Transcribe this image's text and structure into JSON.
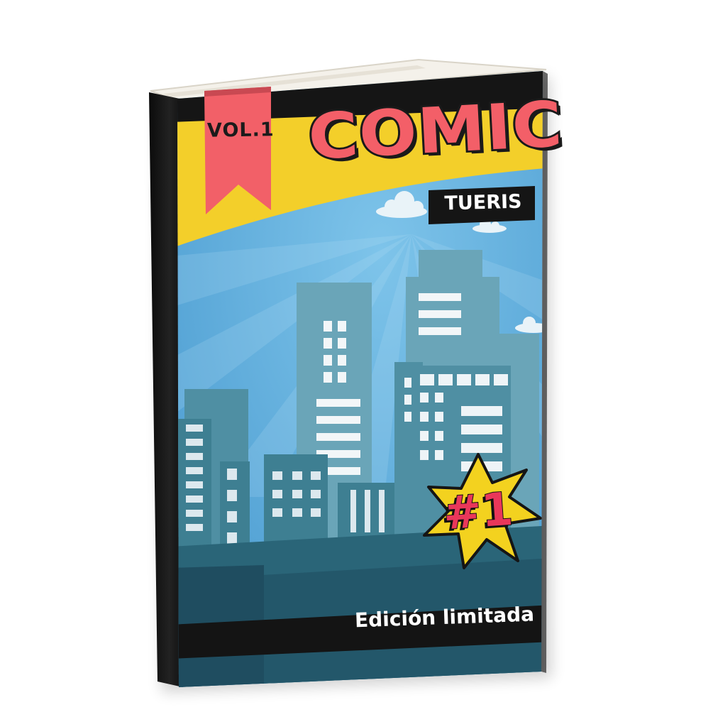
{
  "book": {
    "volume": "VOL.1",
    "title": "COMIC",
    "author": "TUERIS",
    "issue": "#1",
    "edition": "Edición limitada"
  },
  "colors": {
    "spine": "#161616",
    "sky": "#59a9d8",
    "yellow_band": "#f3cf2a",
    "title_fill": "#f35f68",
    "ribbon": "#f26068",
    "buildings_back": "#5f98ab",
    "buildings_front": "#3e7f92",
    "foreground": "#275d71",
    "starburst": "#f3d21f",
    "black_band": "#141414"
  }
}
